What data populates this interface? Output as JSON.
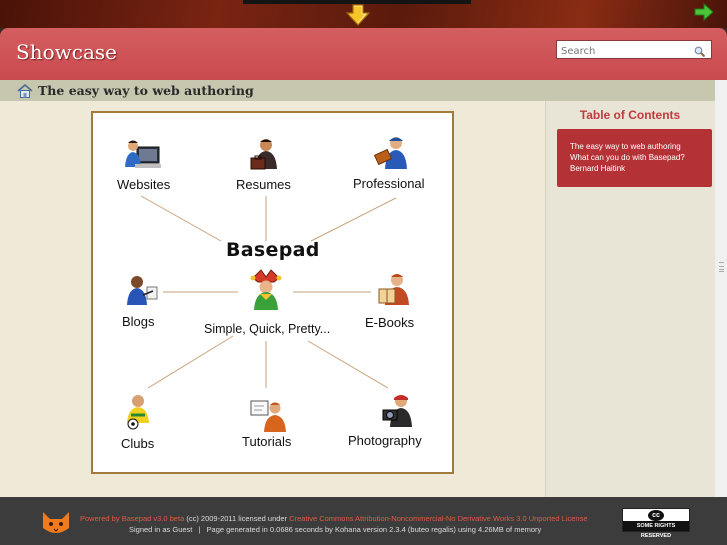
{
  "site": {
    "title": "Showcase"
  },
  "search": {
    "placeholder": "Search"
  },
  "page": {
    "heading": "The easy way to web authoring"
  },
  "toc": {
    "title": "Table of Contents",
    "items": [
      "The easy way to web authoring",
      "What can you do with Basepad?",
      "Bernard Haitink"
    ]
  },
  "diagram": {
    "center_title": "Basepad",
    "center_subtitle": "Simple, Quick, Pretty...",
    "nodes": {
      "websites": "Websites",
      "resumes": "Resumes",
      "professional": "Professional",
      "blogs": "Blogs",
      "ebooks": "E-Books",
      "clubs": "Clubs",
      "tutorials": "Tutorials",
      "photography": "Photography"
    }
  },
  "footer": {
    "powered_link": "Powered by Basepad v3.0 beta",
    "copyright": " (cc) 2009-2011 licensed under ",
    "license_link": "Creative Commons Attribution-Noncommercial-No Derivative Works 3.0 Unported License",
    "signed_in": "Signed in as Guest",
    "separator": "|",
    "generated": "Page generated in 0.0686 seconds by Kohana version 2.3.4 (buteo regalis) using 4.26MB of memory",
    "badge_top": "cc",
    "badge_bottom": "SOME RIGHTS RESERVED"
  },
  "icons": {
    "download": "down-arrow-icon",
    "forward": "right-arrow-icon",
    "search": "magnifier-icon",
    "home": "home-icon",
    "logo": "cat-logo-icon"
  },
  "colors": {
    "header": "#c94a4e",
    "toc_box": "#b43236",
    "toc_title": "#c23a3c",
    "crumb_bar": "#c7c6ae",
    "content_bg": "#efead8",
    "footer": "#3c3c3c",
    "diagram_border": "#a27a3c"
  }
}
